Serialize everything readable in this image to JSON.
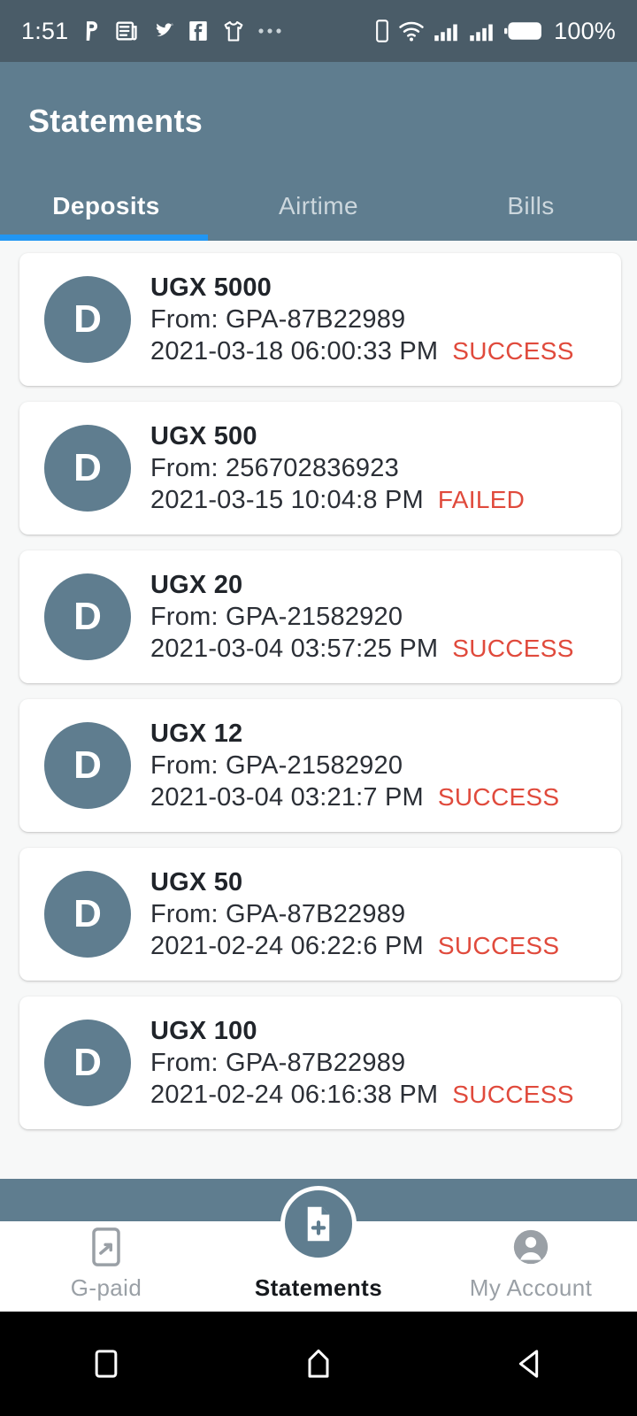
{
  "status_bar": {
    "time": "1:51",
    "battery_percent": "100%",
    "left_icons": [
      "pinterest-icon",
      "news-document-icon",
      "bird-icon",
      "facebook-icon",
      "shirt-icon",
      "more-dots-icon"
    ],
    "right_icons": [
      "vibrate-phone-icon",
      "wifi-icon",
      "signal-bars-icon-1",
      "signal-bars-icon-2",
      "battery-full-icon"
    ],
    "background": "#4a5c68"
  },
  "app_bar": {
    "title": "Statements",
    "background": "#5f7d8f",
    "indicator_color": "#2196f3",
    "tabs": [
      {
        "label": "Deposits",
        "active": true
      },
      {
        "label": "Airtime",
        "active": false
      },
      {
        "label": "Bills",
        "active": false
      }
    ]
  },
  "transactions": [
    {
      "avatar_letter": "D",
      "amount": "UGX 5000",
      "from": "From: GPA-87B22989",
      "date": "2021-03-18 06:00:33 PM",
      "status": "SUCCESS"
    },
    {
      "avatar_letter": "D",
      "amount": "UGX 500",
      "from": "From: 256702836923",
      "date": "2021-03-15 10:04:8 PM",
      "status": "FAILED"
    },
    {
      "avatar_letter": "D",
      "amount": "UGX 20",
      "from": "From: GPA-21582920",
      "date": "2021-03-04 03:57:25 PM",
      "status": "SUCCESS"
    },
    {
      "avatar_letter": "D",
      "amount": "UGX 12",
      "from": "From: GPA-21582920",
      "date": "2021-03-04 03:21:7 PM",
      "status": "SUCCESS"
    },
    {
      "avatar_letter": "D",
      "amount": "UGX 50",
      "from": "From: GPA-87B22989",
      "date": "2021-02-24 06:22:6 PM",
      "status": "SUCCESS"
    },
    {
      "avatar_letter": "D",
      "amount": "UGX 100",
      "from": "From: GPA-87B22989",
      "date": "2021-02-24 06:16:38 PM",
      "status": "SUCCESS"
    }
  ],
  "status_color": "#e04a3c",
  "bottom_nav": {
    "items": [
      {
        "label": "G-paid",
        "icon": "phone-share-icon",
        "active": false
      },
      {
        "label": "Statements",
        "icon": "document-plus-icon",
        "active": true
      },
      {
        "label": "My Account",
        "icon": "person-circle-icon",
        "active": false
      }
    ]
  },
  "android_nav": {
    "icons": [
      "recents-square-icon",
      "home-icon",
      "back-triangle-icon"
    ]
  }
}
